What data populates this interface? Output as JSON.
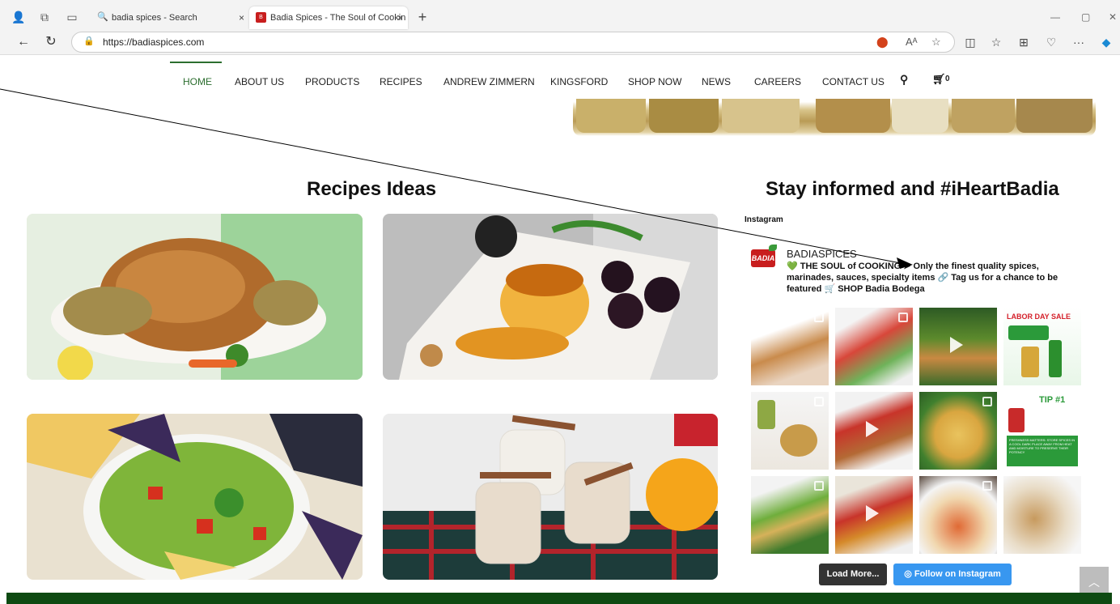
{
  "browser": {
    "tabs": [
      {
        "title": "badia spices - Search",
        "close": "×"
      },
      {
        "title": "Badia Spices - The Soul of Cookin",
        "close": "×"
      }
    ],
    "new_tab": "+",
    "url": "https://badiaspices.com",
    "window_controls": [
      "—",
      "▢",
      "✕"
    ]
  },
  "nav": {
    "items": [
      "HOME",
      "ABOUT US",
      "PRODUCTS",
      "RECIPES",
      "ANDREW ZIMMERN",
      "KINGSFORD",
      "SHOP NOW",
      "NEWS",
      "CAREERS",
      "CONTACT US"
    ],
    "cart_count": "0",
    "active": "HOME"
  },
  "sections": {
    "recipes_title": "Recipes Ideas",
    "social_title": "Stay informed and #iHeartBadia"
  },
  "instagram": {
    "label": "Instagram",
    "logo_text": "BADIA",
    "handle": "BADIASPICES",
    "bio": "💚 THE SOUL of COOKING ➤ Only the finest quality spices, marinades, sauces, specialty items 🔗 Tag us for a chance to be featured 🛒 SHOP Badia Bodega",
    "load_more": "Load More...",
    "follow": "Follow on Instagram",
    "thumb_texts": {
      "labor_day": "LABOR DAY SALE",
      "tip": "TIP #1",
      "freshness": "FRESHNESS MATTERS: STORE SPICES IN A COOL DARK PLACE AWAY FROM HEAT AND MOISTURE TO PRESERVE THEIR POTENCY"
    }
  },
  "icons": {
    "search": "search-icon",
    "cart": "cart-icon",
    "back_to_top": "chevron-up-icon"
  },
  "colors": {
    "brand_green": "#2c6e2f",
    "footer_green": "#0e4a12",
    "badia_red": "#c81e1e",
    "load_more_bg": "#333333",
    "follow_bg": "#3897f0"
  }
}
